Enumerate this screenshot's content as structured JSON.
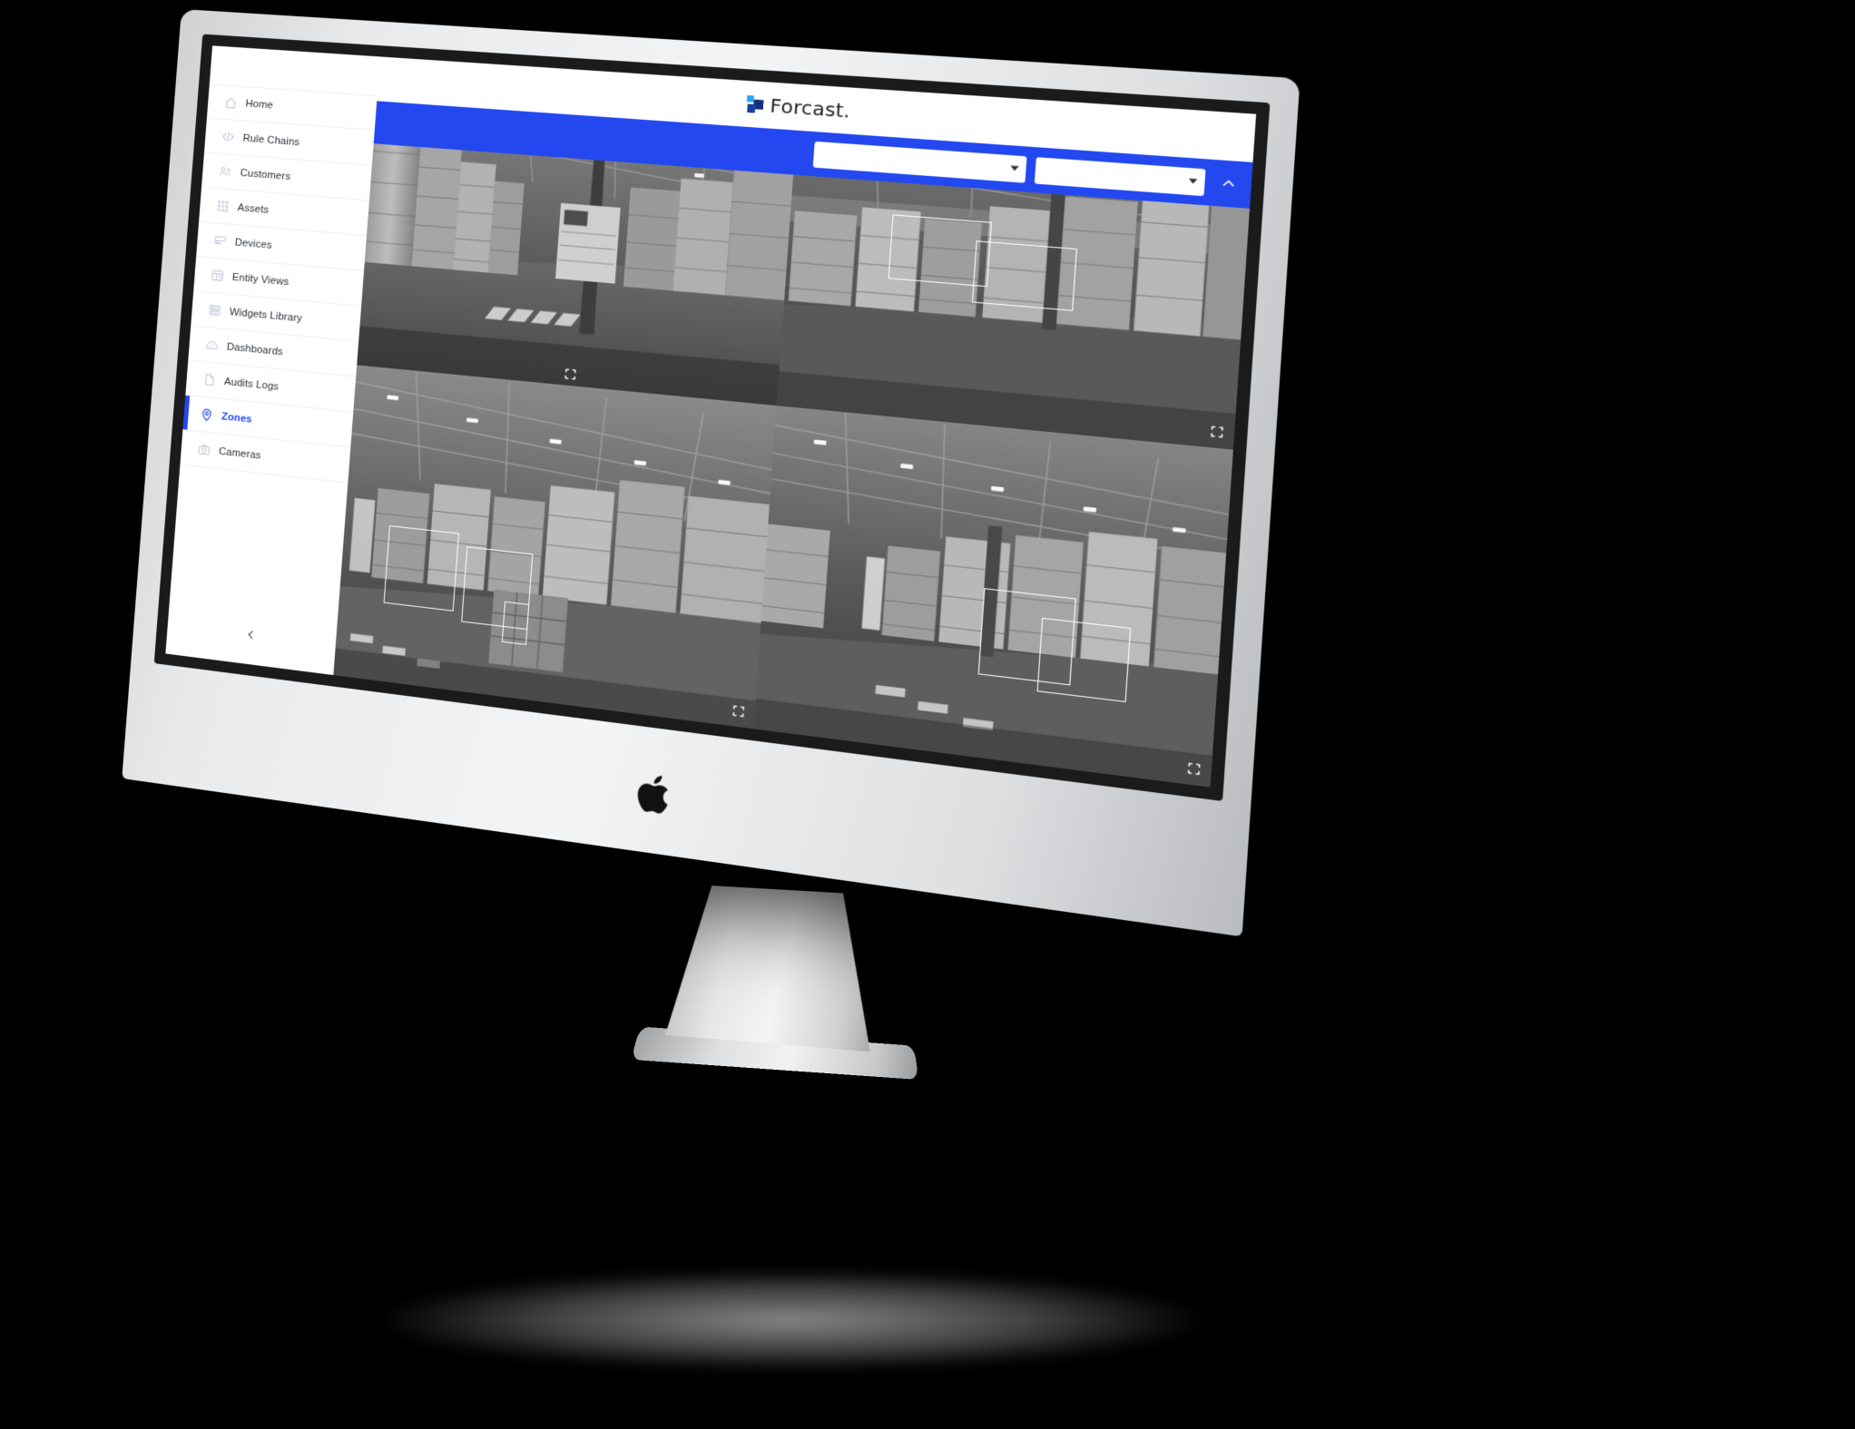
{
  "device": {
    "type": "imac-desktop-monitor",
    "brand_logo": "apple-logo"
  },
  "app": {
    "brand_name": "Forcast.",
    "brand_mark": "forcast-logo-icon",
    "accent_color": "#2348f0",
    "topbar_bg": "#ffffff",
    "filterbar_bg": "#2348f0"
  },
  "sidebar": {
    "collapse_button": "chevron-left-icon",
    "items": [
      {
        "label": "Home",
        "icon": "home-icon",
        "active": false
      },
      {
        "label": "Rule Chains",
        "icon": "code-brackets-icon",
        "active": false
      },
      {
        "label": "Customers",
        "icon": "people-group-icon",
        "active": false
      },
      {
        "label": "Assets",
        "icon": "assets-grid-icon",
        "active": false
      },
      {
        "label": "Devices",
        "icon": "device-icon",
        "active": false
      },
      {
        "label": "Entity Views",
        "icon": "entity-views-icon",
        "active": false
      },
      {
        "label": "Widgets Library",
        "icon": "widgets-icon",
        "active": false
      },
      {
        "label": "Dashboards",
        "icon": "gauge-icon",
        "active": false
      },
      {
        "label": "Audits Logs",
        "icon": "document-icon",
        "active": false
      },
      {
        "label": "Zones",
        "icon": "map-pin-icon",
        "active": true
      },
      {
        "label": "Cameras",
        "icon": "camera-icon",
        "active": false
      }
    ]
  },
  "filterbar": {
    "zone_select": {
      "value": "",
      "placeholder": "",
      "caret": "caret-down-icon"
    },
    "camera_select": {
      "value": "",
      "placeholder": "",
      "caret": "caret-down-icon"
    },
    "collapse_panel_button": "chevron-up-icon"
  },
  "camera_grid": {
    "layout": "2x2",
    "expand_icon": "fullscreen-expand-icon",
    "tiles": [
      {
        "name": "camera-feed-1",
        "scene": "warehouse-aisle-pallets",
        "detections": 0
      },
      {
        "name": "camera-feed-2",
        "scene": "warehouse-racking-right",
        "detections": 2
      },
      {
        "name": "camera-feed-3",
        "scene": "warehouse-wide-aisle",
        "detections": 3
      },
      {
        "name": "camera-feed-4",
        "scene": "warehouse-loading-aisle",
        "detections": 2
      }
    ]
  }
}
